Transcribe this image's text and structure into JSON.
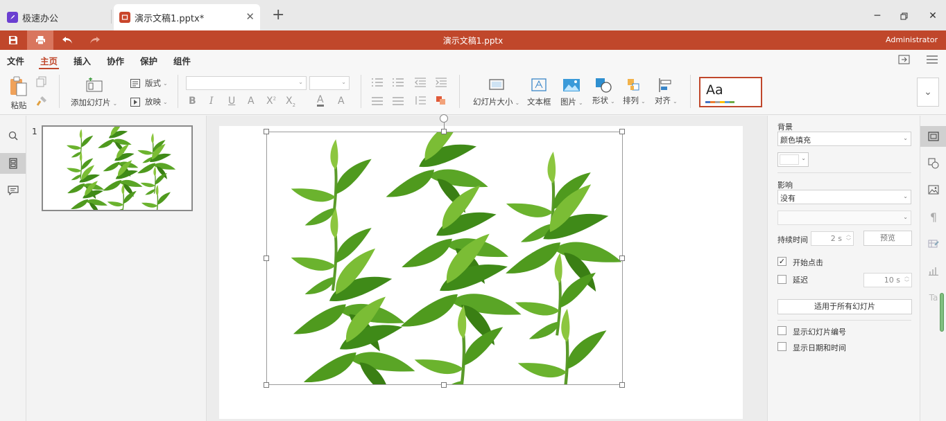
{
  "tabs": [
    {
      "label": "极速办公",
      "icon": "rocket-icon"
    },
    {
      "label": "演示文稿1.pptx*",
      "icon": "presentation-icon"
    }
  ],
  "titlebar": {
    "document_title": "演示文稿1.pptx",
    "user": "Administrator"
  },
  "menu": [
    "文件",
    "主页",
    "插入",
    "协作",
    "保护",
    "组件"
  ],
  "ribbon": {
    "paste": "粘贴",
    "add_slide": "添加幻灯片",
    "layout": "版式",
    "play": "放映",
    "slide_size": "幻灯片大小",
    "textbox": "文本框",
    "image": "图片",
    "shape": "形状",
    "arrange": "排列",
    "align": "对齐",
    "theme_preview": "Aa"
  },
  "slides": [
    {
      "number": "1"
    }
  ],
  "properties": {
    "background_label": "背景",
    "background_fill": "颜色填充",
    "effect_label": "影响",
    "effect_value": "没有",
    "effect_sub": "",
    "duration_label": "持续时间",
    "duration_value": "2 s",
    "preview_button": "预览",
    "start_on_click": "开始点击",
    "start_on_click_checked": true,
    "delay_label": "延迟",
    "delay_checked": false,
    "delay_value": "10 s",
    "apply_all": "适用于所有幻灯片",
    "show_slide_number": "显示幻灯片编号",
    "show_date_time": "显示日期和时间"
  },
  "colors": {
    "accent": "#c0472b",
    "leaf": "#4f9a1e",
    "leaf_light": "#8cc63f"
  }
}
